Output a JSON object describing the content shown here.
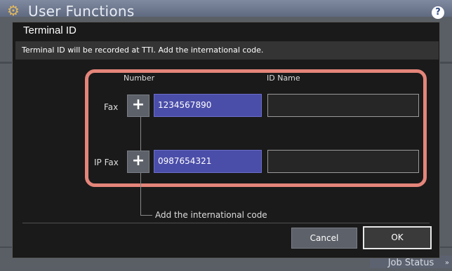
{
  "app": {
    "title": "User Functions",
    "help_label": "?"
  },
  "job_status": {
    "label": "Job Status",
    "chevron": "»"
  },
  "dialog": {
    "title": "Terminal ID",
    "message": "Terminal ID will be recorded at TTI. Add the international code.",
    "columns": {
      "number": "Number",
      "id_name": "ID Name"
    },
    "rows": [
      {
        "label": "Fax",
        "plus": "+",
        "number": "1234567890",
        "id_name": ""
      },
      {
        "label": "IP Fax",
        "plus": "+",
        "number": "0987654321",
        "id_name": ""
      }
    ],
    "note": "Add the international code",
    "buttons": {
      "cancel": "Cancel",
      "ok": "OK"
    }
  },
  "colors": {
    "highlight_frame": "#e5857a",
    "number_field": "#4b4ea9",
    "dialog_bg": "#1a1a1a"
  }
}
